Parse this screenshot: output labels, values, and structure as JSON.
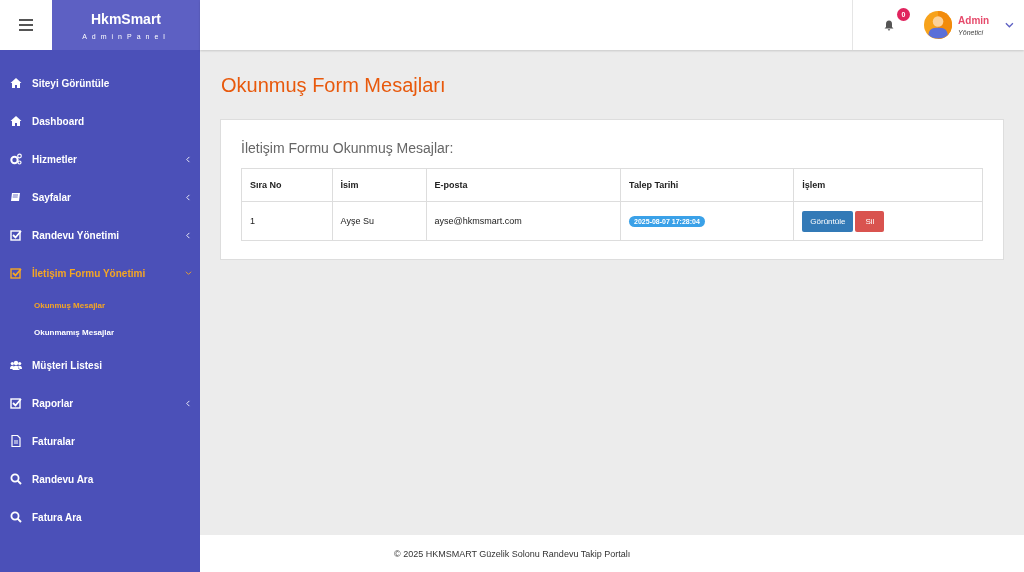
{
  "brand": {
    "title": "HkmSmart",
    "subtitle": "AdminPanel"
  },
  "header": {
    "notification_count": "0",
    "user": {
      "name": "Admin",
      "role": "Yönetici"
    }
  },
  "sidebar": {
    "items": [
      {
        "label": "Siteyi Görüntüle",
        "selected": false
      },
      {
        "label": "Dashboard",
        "selected": false
      },
      {
        "label": "Hizmetler",
        "selected": false,
        "expanded": false
      },
      {
        "label": "Sayfalar",
        "selected": false,
        "expanded": false
      },
      {
        "label": "Randevu Yönetimi",
        "selected": false,
        "expanded": false
      },
      {
        "label": "İletişim Formu Yönetimi",
        "selected": true,
        "expanded": true,
        "children": [
          {
            "label": "Okunmuş Mesajlar",
            "selected": true
          },
          {
            "label": "Okunmamış Mesajlar",
            "selected": false
          }
        ]
      },
      {
        "label": "Müşteri Listesi",
        "selected": false
      },
      {
        "label": "Raporlar",
        "selected": false,
        "expanded": false
      },
      {
        "label": "Faturalar",
        "selected": false
      },
      {
        "label": "Randevu Ara",
        "selected": false
      },
      {
        "label": "Fatura Ara",
        "selected": false
      }
    ]
  },
  "page_title": "Okunmuş Form Mesajları",
  "card": {
    "title": "İletişim Formu Okunmuş Mesajlar:",
    "table": {
      "columns": [
        "Sıra No",
        "İsim",
        "E-posta",
        "Talep Tarihi",
        "İşlem"
      ],
      "rows": [
        {
          "no": "1",
          "name": "Ayşe Su",
          "email": "ayse@hkmsmart.com",
          "date": "2025-08-07 17:28:04",
          "actions": [
            "Görüntüle",
            "Sil"
          ]
        }
      ]
    }
  },
  "footer": "© 2025 HKMSMART Güzelik Solonu Randevu Takip Portalı"
}
